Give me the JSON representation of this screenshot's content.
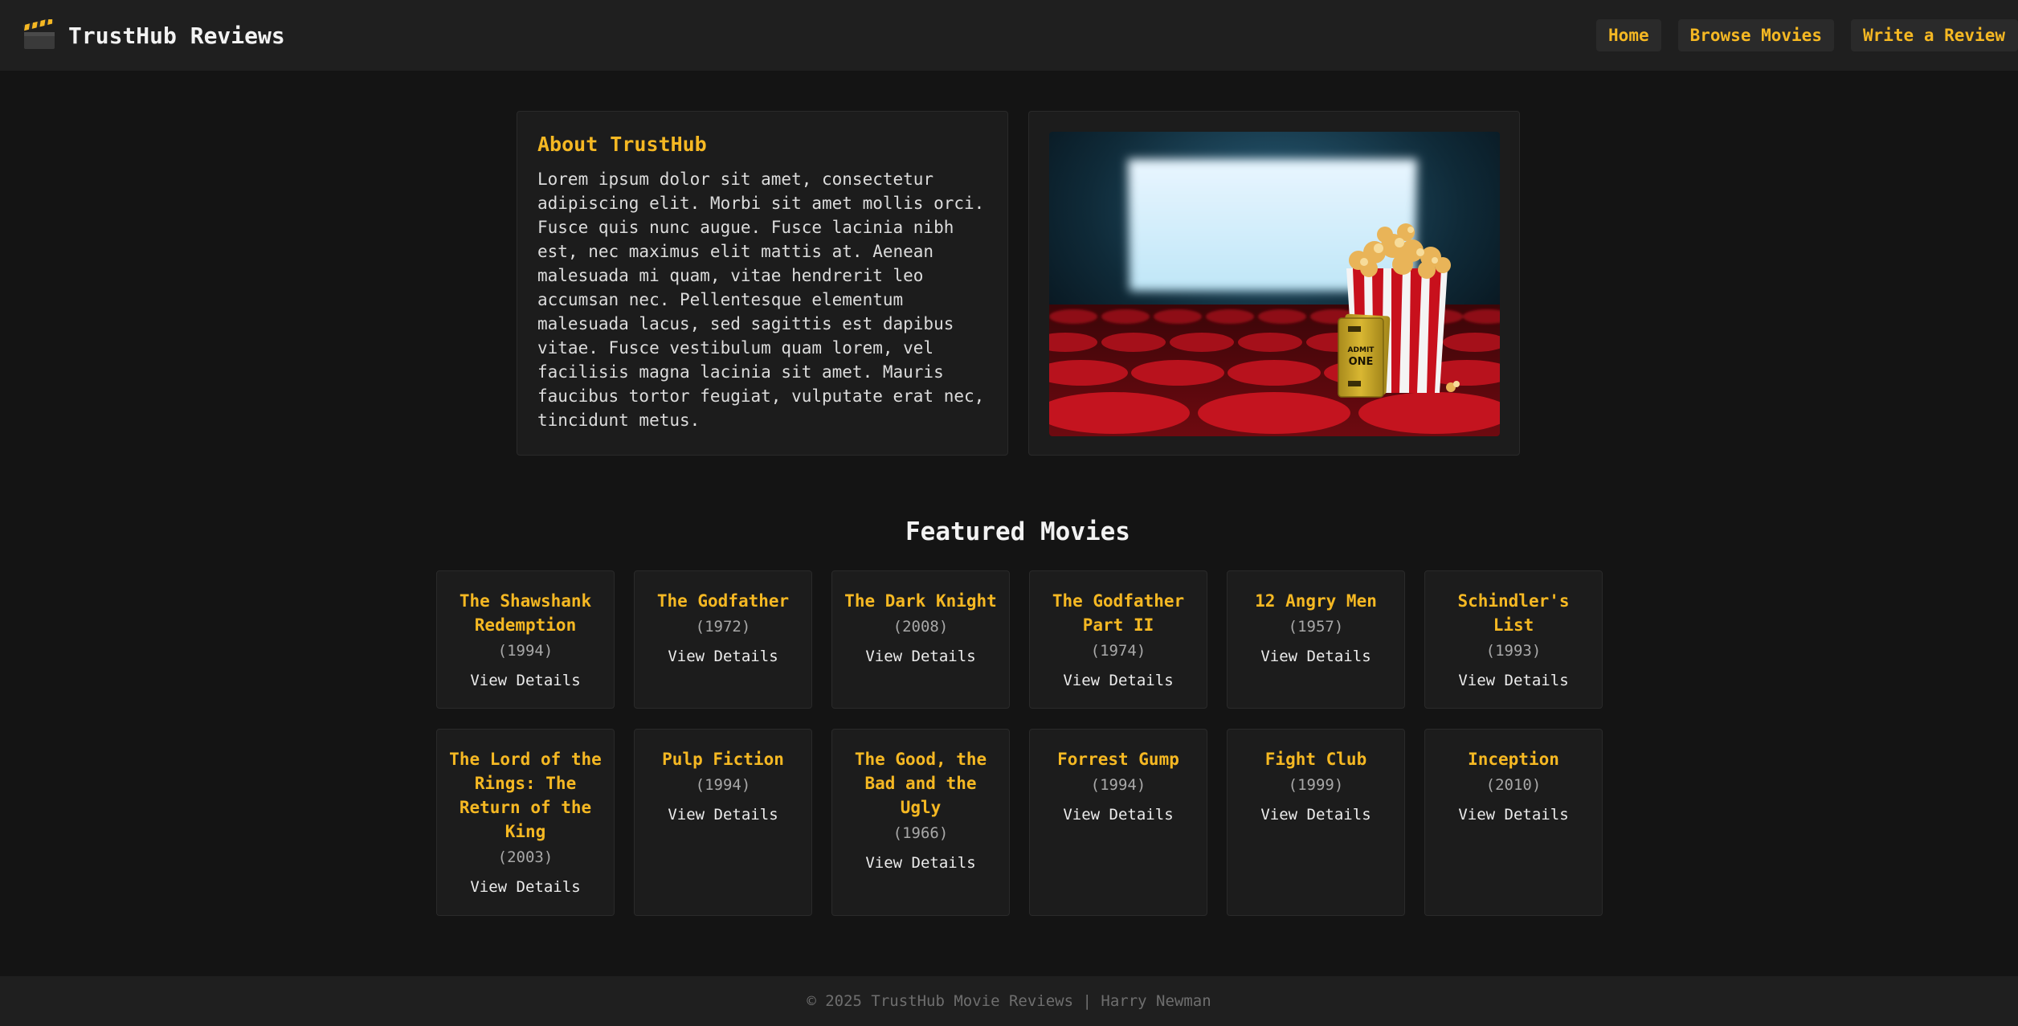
{
  "header": {
    "brand_icon": "clapperboard-icon",
    "title": "TrustHub Reviews",
    "nav": [
      {
        "label": "Home"
      },
      {
        "label": "Browse Movies"
      },
      {
        "label": "Write a Review"
      }
    ]
  },
  "about": {
    "title": "About TrustHub",
    "body": "Lorem ipsum dolor sit amet, consectetur adipiscing elit. Morbi sit amet mollis orci. Fusce quis nunc augue. Fusce lacinia nibh est, nec maximus elit mattis at. Aenean malesuada mi quam, vitae hendrerit leo accumsan nec. Pellentesque elementum malesuada lacus, sed sagittis est dapibus vitae. Fusce vestibulum quam lorem, vel facilisis magna lacinia sit amet. Mauris faucibus tortor feugiat, vulputate erat nec, tincidunt metus.",
    "image_ticket_text": [
      "ADMIT",
      "ONE"
    ]
  },
  "featured": {
    "heading": "Featured Movies",
    "link_label": "View Details",
    "movies": [
      {
        "title": "The Shawshank Redemption",
        "year": "(1994)"
      },
      {
        "title": "The Godfather",
        "year": "(1972)"
      },
      {
        "title": "The Dark Knight",
        "year": "(2008)"
      },
      {
        "title": "The Godfather Part II",
        "year": "(1974)"
      },
      {
        "title": "12 Angry Men",
        "year": "(1957)"
      },
      {
        "title": "Schindler's List",
        "year": "(1993)"
      },
      {
        "title": "The Lord of the Rings: The Return of the King",
        "year": "(2003)"
      },
      {
        "title": "Pulp Fiction",
        "year": "(1994)"
      },
      {
        "title": "The Good, the Bad and the Ugly",
        "year": "(1966)"
      },
      {
        "title": "Forrest Gump",
        "year": "(1994)"
      },
      {
        "title": "Fight Club",
        "year": "(1999)"
      },
      {
        "title": "Inception",
        "year": "(2010)"
      }
    ]
  },
  "footer": {
    "text": "© 2025 TrustHub Movie Reviews | Harry Newman"
  },
  "colors": {
    "accent": "#f5b823",
    "background": "#141414",
    "surface": "#1c1c1c",
    "header": "#1f1f1f"
  }
}
